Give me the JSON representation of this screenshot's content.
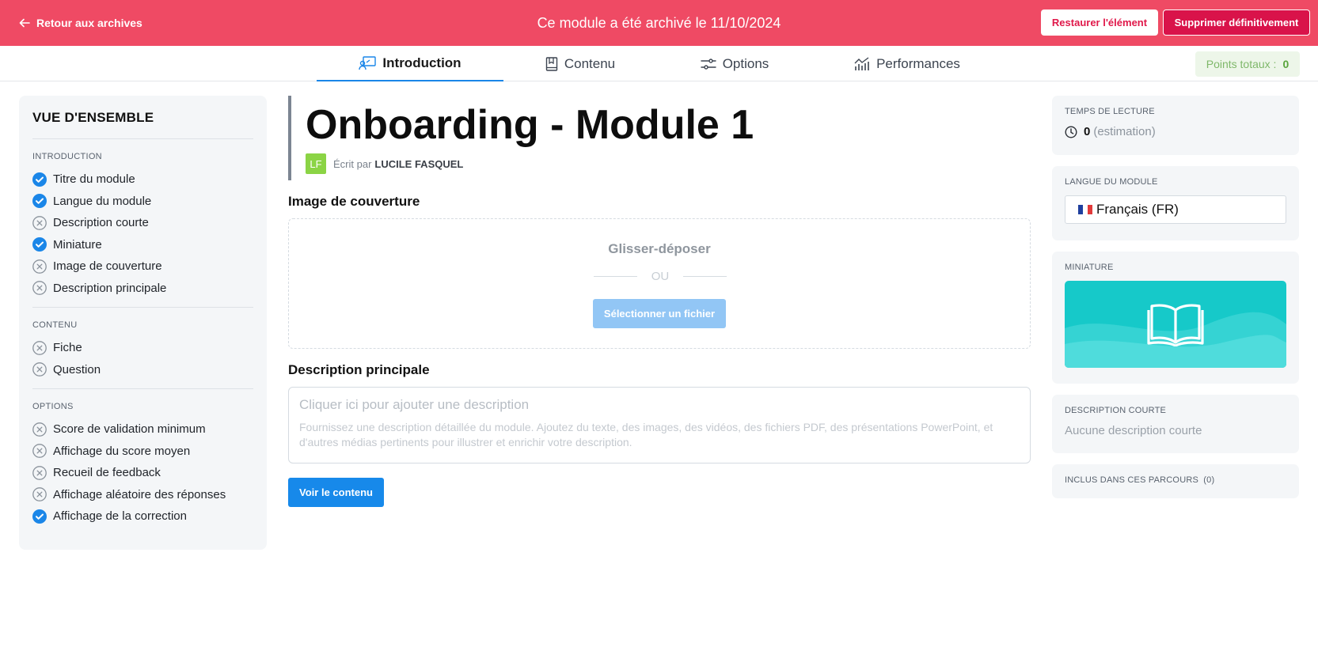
{
  "banner": {
    "back_label": "Retour aux archives",
    "archived_text": "Ce module a été archivé le 11/10/2024",
    "restore_label": "Restaurer l'élément",
    "delete_label": "Supprimer définitivement",
    "color": "#ef4a64"
  },
  "tabs": [
    {
      "label": "Introduction",
      "icon": "presentation-icon",
      "active": true
    },
    {
      "label": "Contenu",
      "icon": "book-icon",
      "active": false
    },
    {
      "label": "Options",
      "icon": "sliders-icon",
      "active": false
    },
    {
      "label": "Performances",
      "icon": "chart-icon",
      "active": false
    }
  ],
  "points": {
    "label": "Points totaux :",
    "value": "0"
  },
  "overview": {
    "title": "VUE D'ENSEMBLE",
    "sections": [
      {
        "label": "INTRODUCTION",
        "items": [
          {
            "label": "Titre du module",
            "done": true
          },
          {
            "label": "Langue du module",
            "done": true
          },
          {
            "label": "Description courte",
            "done": false
          },
          {
            "label": "Miniature",
            "done": true
          },
          {
            "label": "Image de couverture",
            "done": false
          },
          {
            "label": "Description principale",
            "done": false
          }
        ]
      },
      {
        "label": "CONTENU",
        "items": [
          {
            "label": "Fiche",
            "done": false
          },
          {
            "label": "Question",
            "done": false
          }
        ]
      },
      {
        "label": "OPTIONS",
        "items": [
          {
            "label": "Score de validation minimum",
            "done": false
          },
          {
            "label": "Affichage du score moyen",
            "done": false
          },
          {
            "label": "Recueil de feedback",
            "done": false
          },
          {
            "label": "Affichage aléatoire des réponses",
            "done": false
          },
          {
            "label": "Affichage de la correction",
            "done": true
          }
        ]
      }
    ]
  },
  "module": {
    "title": "Onboarding - Module 1",
    "author_initials": "LF",
    "written_by": "Écrit par",
    "author_name": "LUCILE FASQUEL"
  },
  "cover": {
    "heading": "Image de couverture",
    "drag_text": "Glisser-déposer",
    "or_text": "OU",
    "select_label": "Sélectionner un fichier"
  },
  "description": {
    "heading": "Description principale",
    "placeholder": "Cliquer ici pour ajouter une description",
    "help": "Fournissez une description détaillée du module. Ajoutez du texte, des images, des vidéos, des fichiers PDF, des présentations PowerPoint, et d'autres médias pertinents pour illustrer et enrichir votre description."
  },
  "view_content_label": "Voir le contenu",
  "right": {
    "reading_label": "TEMPS DE LECTURE",
    "reading_value": "0",
    "reading_note": "(estimation)",
    "language_label": "LANGUE DU MODULE",
    "language_value": "Français (FR)",
    "thumbnail_label": "MINIATURE",
    "short_desc_label": "DESCRIPTION COURTE",
    "short_desc_value": "Aucune description courte",
    "paths_label": "INCLUS DANS CES PARCOURS",
    "paths_count": "(0)"
  },
  "colors": {
    "accent": "#1789ea",
    "check": "#1a86e8",
    "thumbnail": "#16c9c9",
    "avatar": "#8bd445"
  }
}
